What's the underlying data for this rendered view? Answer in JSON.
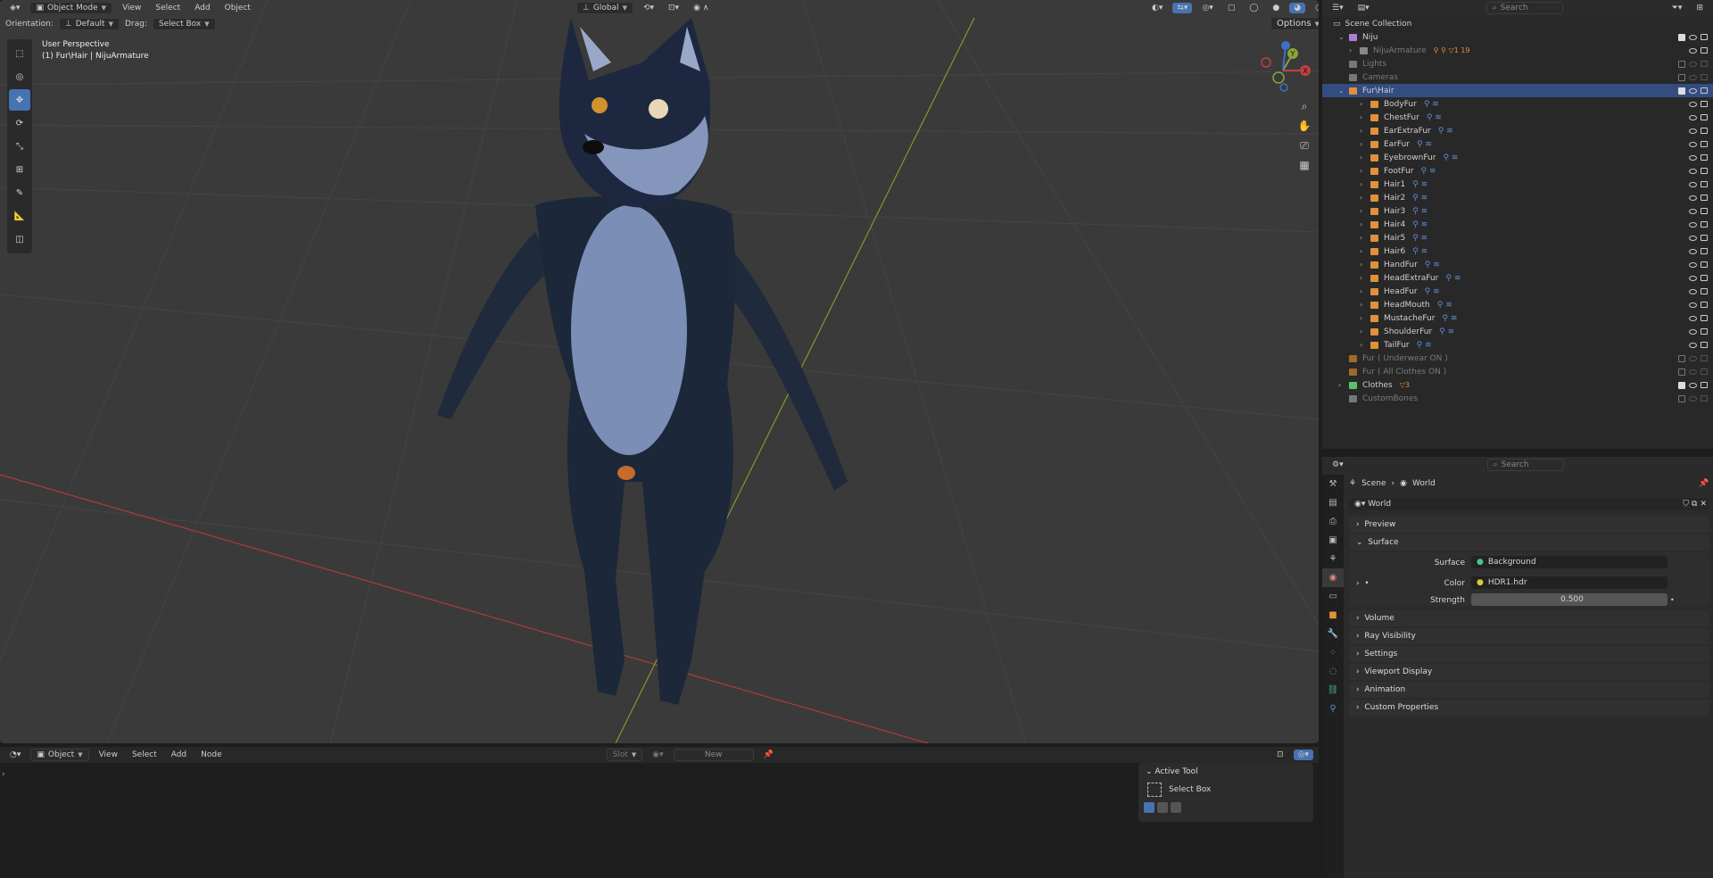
{
  "topbar": {
    "editor_icon": "cube-editor-icon",
    "mode": "Object Mode",
    "menus": [
      "View",
      "Select",
      "Add",
      "Object"
    ],
    "transform": "Global",
    "options": "Options"
  },
  "toolbar2": {
    "orientation_label": "Orientation:",
    "orientation_value": "Default",
    "drag_label": "Drag:",
    "drag_value": "Select Box"
  },
  "viewport": {
    "perspective": "User Perspective",
    "object": "(1) Fur\\Hair | NijuArmature",
    "gizmo": {
      "x": "X",
      "y": "Y",
      "z": "Z"
    }
  },
  "outliner": {
    "search_placeholder": "Search",
    "root": "Scene Collection",
    "rows": [
      {
        "label": "Niju",
        "indent": 1,
        "color": "#b07cd6",
        "expand": "v",
        "vis": "full"
      },
      {
        "label": "NijuArmature",
        "indent": 2,
        "color": "#888",
        "expand": ">",
        "vis": "partial",
        "dim": true,
        "extras": "⚲ ⚲ ▽1 19"
      },
      {
        "label": "Lights",
        "indent": 1,
        "color": "#777",
        "vis": "off",
        "dim": true
      },
      {
        "label": "Cameras",
        "indent": 1,
        "color": "#777",
        "vis": "off",
        "dim": true
      },
      {
        "label": "Fur\\Hair",
        "indent": 1,
        "color": "#e0913a",
        "expand": "v",
        "vis": "full",
        "sel": true
      },
      {
        "label": "BodyFur",
        "indent": 3,
        "color": "#e0913a",
        "expand": ">",
        "vis": "eye"
      },
      {
        "label": "ChestFur",
        "indent": 3,
        "color": "#e0913a",
        "expand": ">",
        "vis": "eye"
      },
      {
        "label": "EarExtraFur",
        "indent": 3,
        "color": "#e0913a",
        "expand": ">",
        "vis": "eye"
      },
      {
        "label": "EarFur",
        "indent": 3,
        "color": "#e0913a",
        "expand": ">",
        "vis": "eye"
      },
      {
        "label": "EyebrownFur",
        "indent": 3,
        "color": "#e0913a",
        "expand": ">",
        "vis": "eye"
      },
      {
        "label": "FootFur",
        "indent": 3,
        "color": "#e0913a",
        "expand": ">",
        "vis": "eye"
      },
      {
        "label": "Hair1",
        "indent": 3,
        "color": "#e0913a",
        "expand": ">",
        "vis": "eye"
      },
      {
        "label": "Hair2",
        "indent": 3,
        "color": "#e0913a",
        "expand": ">",
        "vis": "eye"
      },
      {
        "label": "Hair3",
        "indent": 3,
        "color": "#e0913a",
        "expand": ">",
        "vis": "eye"
      },
      {
        "label": "Hair4",
        "indent": 3,
        "color": "#e0913a",
        "expand": ">",
        "vis": "eye"
      },
      {
        "label": "Hair5",
        "indent": 3,
        "color": "#e0913a",
        "expand": ">",
        "vis": "eye"
      },
      {
        "label": "Hair6",
        "indent": 3,
        "color": "#e0913a",
        "expand": ">",
        "vis": "eye"
      },
      {
        "label": "HandFur",
        "indent": 3,
        "color": "#e0913a",
        "expand": ">",
        "vis": "eye"
      },
      {
        "label": "HeadExtraFur",
        "indent": 3,
        "color": "#e0913a",
        "expand": ">",
        "vis": "eye"
      },
      {
        "label": "HeadFur",
        "indent": 3,
        "color": "#e0913a",
        "expand": ">",
        "vis": "eye"
      },
      {
        "label": "HeadMouth",
        "indent": 3,
        "color": "#e0913a",
        "expand": ">",
        "vis": "eye"
      },
      {
        "label": "MustacheFur",
        "indent": 3,
        "color": "#e0913a",
        "expand": ">",
        "vis": "eye"
      },
      {
        "label": "ShoulderFur",
        "indent": 3,
        "color": "#e0913a",
        "expand": ">",
        "vis": "eye"
      },
      {
        "label": "TailFur",
        "indent": 3,
        "color": "#e0913a",
        "expand": ">",
        "vis": "eye"
      },
      {
        "label": "Fur ( Underwear ON )",
        "indent": 1,
        "color": "#a0682b",
        "vis": "off",
        "dim": true
      },
      {
        "label": "Fur ( All Clothes ON )",
        "indent": 1,
        "color": "#a0682b",
        "vis": "off",
        "dim": true
      },
      {
        "label": "Clothes",
        "indent": 1,
        "color": "#5cc06a",
        "expand": ">",
        "vis": "full",
        "extras": "▽3"
      },
      {
        "label": "CustomBones",
        "indent": 1,
        "color": "#777",
        "vis": "off",
        "dim": true
      }
    ]
  },
  "properties": {
    "search_placeholder": "Search",
    "breadcrumb": [
      "Scene",
      "World"
    ],
    "datablock": "World",
    "panels": [
      "Preview",
      "Surface",
      "Volume",
      "Ray Visibility",
      "Settings",
      "Viewport Display",
      "Animation",
      "Custom Properties"
    ],
    "surface_label": "Surface",
    "surface_value": "Background",
    "color_label": "Color",
    "color_value": "HDR1.hdr",
    "strength_label": "Strength",
    "strength_value": "0.500"
  },
  "nodeeditor": {
    "type": "Object",
    "menus": [
      "View",
      "Select",
      "Add",
      "Node"
    ],
    "slot": "Slot",
    "new": "New"
  },
  "active_tool": {
    "title": "Active Tool",
    "tool": "Select Box"
  },
  "colors": {
    "accent": "#4772b3",
    "selected_row": "#334d80",
    "axis_x": "#c04040",
    "axis_y": "#8ca33a"
  }
}
